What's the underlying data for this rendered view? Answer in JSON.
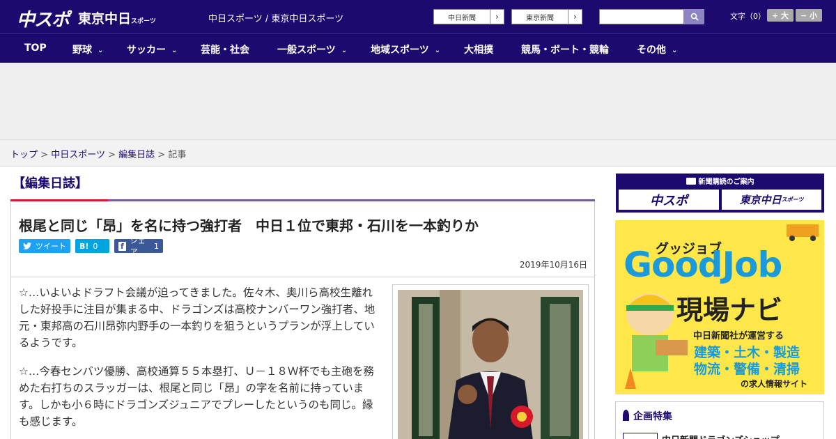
{
  "header": {
    "logo_main": "中スポ",
    "logo_tokyo": "東京中日",
    "logo_tokyo_small": "スポーツ",
    "site_links": "中日スポーツ / 東京中日スポーツ",
    "paper_chunichi": "中日新聞",
    "paper_tokyo": "東京新聞",
    "arrow": "›",
    "search_icon": "search-icon",
    "font_label": "文字（0）",
    "font_bigger": "+ 大",
    "font_smaller": "− 小"
  },
  "nav": {
    "chevron": "⌄",
    "items": [
      {
        "label": "TOP"
      },
      {
        "label": "野球"
      },
      {
        "label": "サッカー"
      },
      {
        "label": "芸能・社会"
      },
      {
        "label": "一般スポーツ"
      },
      {
        "label": "地域スポーツ"
      },
      {
        "label": "大相撲"
      },
      {
        "label": "競馬・ボート・競輪"
      },
      {
        "label": "その他"
      }
    ]
  },
  "breadcrumb": {
    "home": "トップ",
    "site": "中日スポーツ",
    "section": "編集日誌",
    "current": "記事",
    "sep": ">"
  },
  "article": {
    "section_title": "【編集日誌】",
    "headline": "根尾と同じ「昂」を名に持つ強打者　中日１位で東邦・石川を一本釣りか",
    "share": {
      "tweet": "ツイート",
      "hatena_icon": "B!",
      "hatena_count": "0",
      "facebook_icon": "f",
      "facebook_label": "シェア",
      "facebook_count": "1"
    },
    "date": "2019年10月16日",
    "paragraphs": [
      "☆…いよいよドラフト会議が迫ってきました。佐々木、奥川ら高校生離れした好投手に注目が集まる中、ドラゴンズは高校ナンバーワン強打者、地元・東邦高の石川昂弥内野手の一本釣りを狙うというプランが浮上しているようです。",
      "☆…今春センバツ優勝、高校通算５５本塁打、Ｕ－１８Ｗ杯でも主砲を務めた右打ちのスラッガーは、根尾と同じ「昂」の字を名前に持っています。しかも小６時にドラゴンズジュニアでプレーしたというのも同じ。縁も感じます。"
    ]
  },
  "sidebar": {
    "subscribe_title": "新聞購読のご案内",
    "sub_chuspo": "中スポ",
    "sub_tokyo": "東京中日",
    "sub_tokyo_small": "スポーツ",
    "goodjob_katakana": "グッジョブ",
    "goodjob_title": "GoodJob",
    "goodjob_navi": "現場ナビ",
    "goodjob_operator": "中日新聞社が運営する",
    "goodjob_line1": "建築・土木・製造",
    "goodjob_line2": "物流・警備・清掃",
    "goodjob_footer": "の求人情報サイト",
    "kikaku_title": "企画特集",
    "kikaku_item": "中日新聞ドラゴンズショップ"
  },
  "colors": {
    "brand_navy": "#1e0a6e",
    "accent_red": "#d8192a",
    "twitter": "#1da1f2",
    "hatena": "#00a4de",
    "facebook": "#3b5998",
    "goodjob_yellow": "#ffe74a",
    "goodjob_blue": "#1a9ad9"
  }
}
